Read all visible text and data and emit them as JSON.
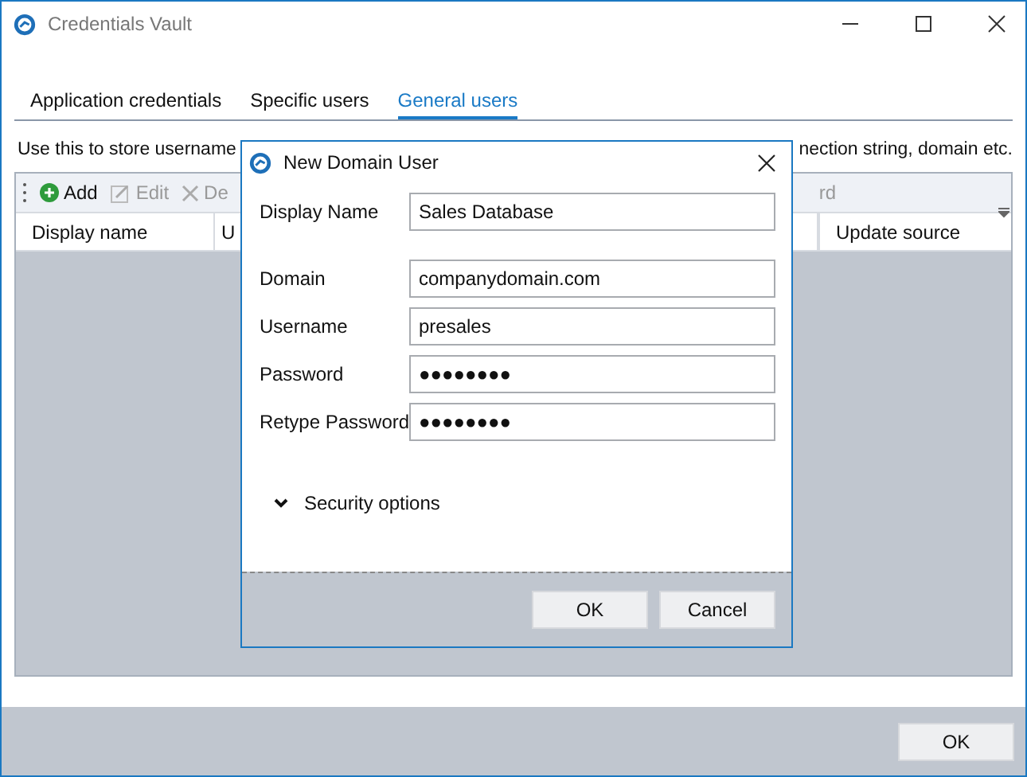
{
  "window": {
    "title": "Credentials Vault"
  },
  "tabs": [
    {
      "label": "Application credentials",
      "selected": false
    },
    {
      "label": "Specific users",
      "selected": false
    },
    {
      "label": "General users",
      "selected": true
    }
  ],
  "description": {
    "left": "Use this to store username",
    "right": "nection string, domain etc."
  },
  "toolbar": [
    {
      "label": "Add",
      "disabled": false
    },
    {
      "label": "Edit",
      "disabled": true
    },
    {
      "label": "De",
      "disabled": true
    }
  ],
  "toolbar_tail": "rd",
  "table": {
    "columns": [
      "Display name",
      "U",
      "Update source"
    ]
  },
  "dialog": {
    "title": "New Domain User",
    "fields": [
      {
        "label": "Display Name",
        "value": "Sales Database"
      },
      {
        "label": "Domain",
        "value": "companydomain.com"
      },
      {
        "label": "Username",
        "value": "presales"
      },
      {
        "label": "Password",
        "value": "●●●●●●●●"
      },
      {
        "label": "Retype Password",
        "value": "●●●●●●●●"
      }
    ],
    "section": {
      "label": "Security options",
      "expanded": false
    },
    "buttons": [
      "OK",
      "Cancel"
    ]
  },
  "footer_buttons": [
    "OK"
  ]
}
